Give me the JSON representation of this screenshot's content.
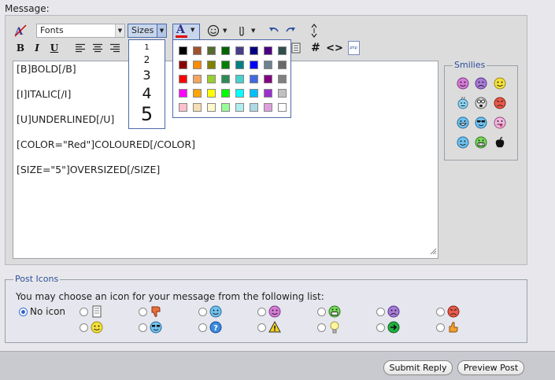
{
  "message_label": "Message:",
  "toolbar": {
    "fonts_label": "Fonts",
    "sizes_label": "Sizes",
    "bold_label": "B",
    "italic_label": "I",
    "underline_label": "U",
    "hash_label": "#",
    "code_label": "<>",
    "php_label": "php",
    "font_color_label": "A"
  },
  "sizes_dropdown": [
    "1",
    "2",
    "3",
    "4",
    "5"
  ],
  "color_palette": [
    [
      "#000000",
      "#a0522d",
      "#556b2f",
      "#006400",
      "#483d8b",
      "#000080",
      "#4b0082",
      "#2f4f4f"
    ],
    [
      "#8b0000",
      "#ff8c00",
      "#808000",
      "#008000",
      "#008080",
      "#0000ff",
      "#708090",
      "#696969"
    ],
    [
      "#ff0000",
      "#f4a460",
      "#9acd32",
      "#2e8b57",
      "#48d1cc",
      "#4169e1",
      "#800080",
      "#808080"
    ],
    [
      "#ff00ff",
      "#ffa500",
      "#ffff00",
      "#00ff00",
      "#00ffff",
      "#00bfff",
      "#9932cc",
      "#c0c0c0"
    ],
    [
      "#ffc0cb",
      "#f5deb3",
      "#fffacd",
      "#98fb98",
      "#afeeee",
      "#add8e6",
      "#dda0dd",
      "#ffffff"
    ]
  ],
  "message_lines": [
    "[B]BOLD[/B]",
    "[I]ITALIC[/I]",
    "[U]UNDERLINED[/U]",
    "[COLOR=\"Red\"]COLOURED[/COLOR]",
    "[SIZE=\"5\"]OVERSIZED[/SIZE]"
  ],
  "smilies": {
    "legend": "Smilies"
  },
  "post_icons": {
    "legend": "Post Icons",
    "instruction": "You may choose an icon for your message from the following list:",
    "no_icon_label": "No icon",
    "selected": "No icon"
  },
  "buttons": {
    "submit": "Submit Reply",
    "preview": "Preview Post"
  }
}
